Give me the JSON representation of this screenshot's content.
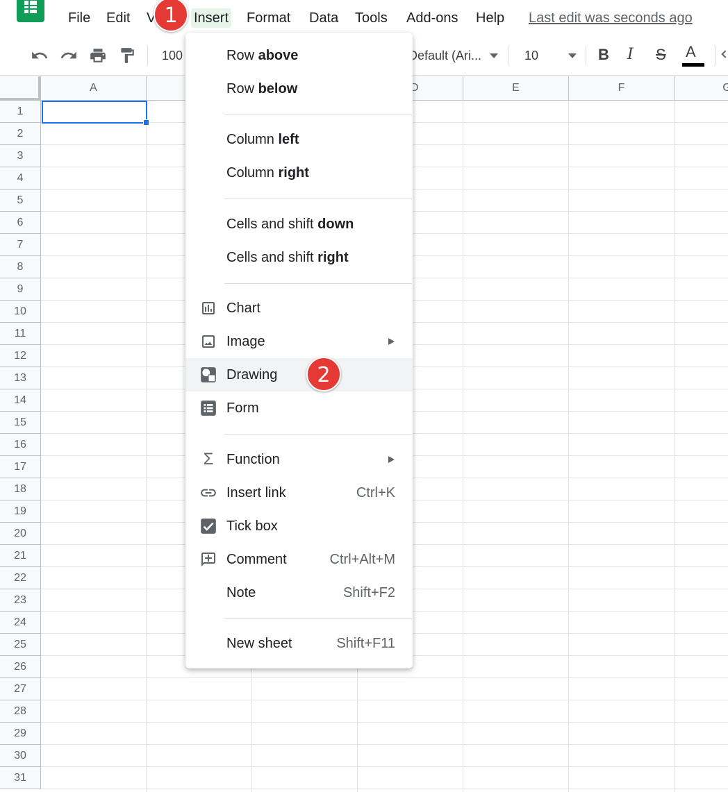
{
  "menubar": {
    "items": [
      "File",
      "Edit",
      "V",
      "Insert",
      "Format",
      "Data",
      "Tools",
      "Add-ons",
      "Help"
    ],
    "last_edit": "Last edit was seconds ago"
  },
  "toolbar": {
    "zoom": "100",
    "font_name": "Default (Ari...",
    "font_size": "10",
    "bold": "B",
    "italic": "I",
    "strike": "S",
    "text_color": "A"
  },
  "grid": {
    "columns": [
      "A",
      "",
      "",
      "D",
      "E",
      "F",
      "G"
    ],
    "rows": [
      "1",
      "2",
      "3",
      "4",
      "5",
      "6",
      "7",
      "8",
      "9",
      "10",
      "11",
      "12",
      "13",
      "14",
      "15",
      "16",
      "17",
      "18",
      "19",
      "20",
      "21",
      "22",
      "23",
      "24",
      "25",
      "26",
      "27",
      "28",
      "29",
      "30",
      "31"
    ]
  },
  "insert_menu": {
    "row_above": {
      "prefix": "Row ",
      "bold": "above"
    },
    "row_below": {
      "prefix": "Row ",
      "bold": "below"
    },
    "column_left": {
      "prefix": "Column ",
      "bold": "left"
    },
    "column_right": {
      "prefix": "Column ",
      "bold": "right"
    },
    "cells_shift_down": {
      "prefix": "Cells and shift ",
      "bold": "down"
    },
    "cells_shift_right": {
      "prefix": "Cells and shift ",
      "bold": "right"
    },
    "chart": "Chart",
    "image": "Image",
    "drawing": "Drawing",
    "form": "Form",
    "function": "Function",
    "insert_link": {
      "label": "Insert link",
      "shortcut": "Ctrl+K"
    },
    "tick_box": "Tick box",
    "comment": {
      "label": "Comment",
      "shortcut": "Ctrl+Alt+M"
    },
    "note": {
      "label": "Note",
      "shortcut": "Shift+F2"
    },
    "new_sheet": {
      "label": "New sheet",
      "shortcut": "Shift+F11"
    }
  },
  "badges": {
    "step1": "1",
    "step2": "2"
  },
  "colors": {
    "accent": "#1a73e8",
    "badge": "#e53935",
    "sheets_green": "#0f9d58",
    "active_menu_bg": "#e6f4ea"
  }
}
